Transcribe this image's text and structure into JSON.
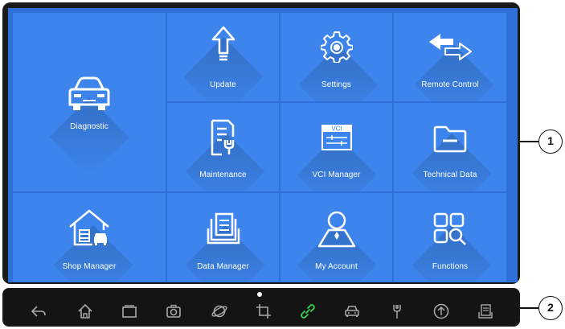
{
  "tiles": [
    {
      "id": "diagnostic",
      "label": "Diagnostic",
      "icon": "car-icon"
    },
    {
      "id": "update",
      "label": "Update",
      "icon": "upload-arrow-icon"
    },
    {
      "id": "settings",
      "label": "Settings",
      "icon": "gear-icon"
    },
    {
      "id": "remote",
      "label": "Remote Control",
      "icon": "bidirectional-arrows-icon"
    },
    {
      "id": "maintenance",
      "label": "Maintenance",
      "icon": "document-wrench-icon"
    },
    {
      "id": "vci",
      "label": "VCI Manager",
      "icon": "vci-window-icon",
      "icon_text": "VCI"
    },
    {
      "id": "techdata",
      "label": "Technical Data",
      "icon": "folder-icon"
    },
    {
      "id": "shop",
      "label": "Shop Manager",
      "icon": "garage-icon"
    },
    {
      "id": "datamgr",
      "label": "Data Manager",
      "icon": "stacked-documents-icon"
    },
    {
      "id": "account",
      "label": "My Account",
      "icon": "person-icon"
    },
    {
      "id": "functions",
      "label": "Functions",
      "icon": "grid-search-icon"
    }
  ],
  "taskbar": [
    "back-icon",
    "home-icon",
    "recent-apps-icon",
    "camera-icon",
    "browser-icon",
    "crop-icon",
    "vci-link-icon",
    "car-icon",
    "wrench-icon",
    "upload-icon",
    "report-icon"
  ],
  "callouts": {
    "one": "1",
    "two": "2"
  },
  "colors": {
    "screen": "#2e6fd8",
    "tile": "#3d85ec",
    "link_active": "#39d353"
  }
}
